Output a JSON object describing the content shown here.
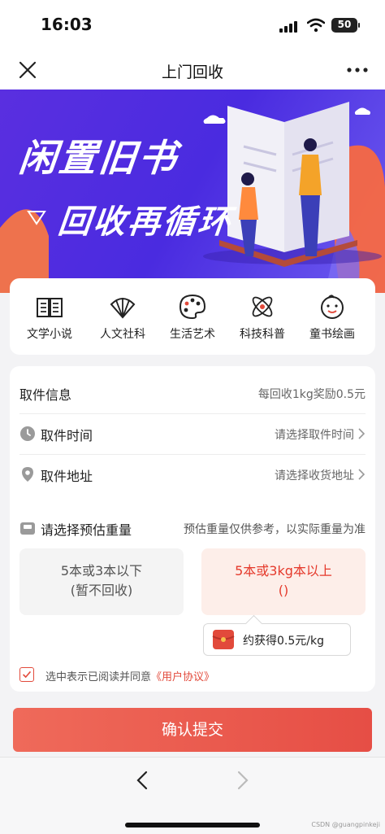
{
  "status_bar": {
    "time": "16:03",
    "battery": "50"
  },
  "nav": {
    "title": "上门回收",
    "close_icon": "close-icon",
    "more_icon": "more-icon"
  },
  "banner": {
    "line1": "闲置旧书",
    "line2": "回收再循环"
  },
  "categories": [
    {
      "label": "文学小说",
      "icon": "open-book-icon"
    },
    {
      "label": "人文社科",
      "icon": "fan-icon"
    },
    {
      "label": "生活艺术",
      "icon": "palette-icon"
    },
    {
      "label": "科技科普",
      "icon": "atom-icon"
    },
    {
      "label": "童书绘画",
      "icon": "baby-face-icon"
    }
  ],
  "pickup": {
    "title": "取件信息",
    "reward_note": "每回收1kg奖励0.5元",
    "time_label": "取件时间",
    "time_placeholder": "请选择取件时间",
    "address_label": "取件地址",
    "address_placeholder": "请选择收货地址"
  },
  "weight": {
    "title": "请选择预估重量",
    "note": "预估重量仅供参考，以实际重量为准",
    "options": [
      {
        "line1": "5本或3本以下",
        "line2": "(暂不回收)",
        "selected": false
      },
      {
        "line1": "5本或3kg本以上",
        "line2": "()",
        "selected": true
      }
    ],
    "reward_text": "约获得0.5元/kg"
  },
  "agreement": {
    "text": "选中表示已阅读并同意",
    "link": "《用户协议》",
    "checked": true
  },
  "submit_label": "确认提交",
  "watermark": "CSDN @guangpinkeji",
  "colors": {
    "accent": "#e64e45",
    "banner": "#5a2fe0"
  }
}
